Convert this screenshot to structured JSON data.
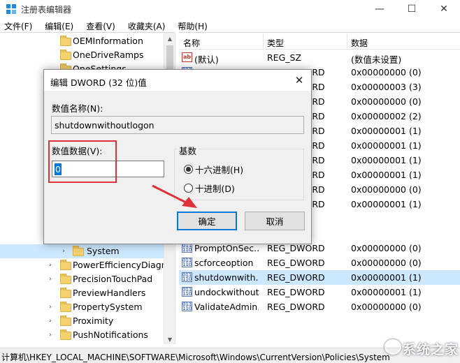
{
  "window": {
    "title": "注册表编辑器",
    "controls": {
      "minimize": "—",
      "maximize": "☐",
      "close": "✕"
    }
  },
  "menu": [
    "文件(F)",
    "编辑(E)",
    "查看(V)",
    "收藏夹(A)",
    "帮助(H)"
  ],
  "tree": {
    "items": [
      {
        "label": "OEMInformation",
        "arrow": ""
      },
      {
        "label": "OneDriveRamps",
        "arrow": ""
      },
      {
        "label": "OneSettings",
        "arrow": ""
      },
      {
        "label": "System",
        "arrow": "›",
        "selected": true
      },
      {
        "label": "PowerEfficiencyDiagnostics",
        "arrow": "›"
      },
      {
        "label": "PrecisionTouchPad",
        "arrow": "›"
      },
      {
        "label": "PreviewHandlers",
        "arrow": ""
      },
      {
        "label": "PropertySystem",
        "arrow": "›"
      },
      {
        "label": "Proximity",
        "arrow": "›"
      },
      {
        "label": "PushNotifications",
        "arrow": "›"
      }
    ]
  },
  "values_table": {
    "headers": {
      "name": "名称",
      "type": "类型",
      "data": "数据"
    },
    "rows": [
      {
        "icon": "string-value-icon",
        "name": "(默认)",
        "type": "REG_SZ",
        "data": "(数值未设置)"
      },
      {
        "icon": "dword-value-icon",
        "name": "",
        "type": "REG_DWORD",
        "data": "0x00000000 (0)"
      },
      {
        "icon": "dword-value-icon",
        "name": "",
        "type": "REG_DWORD",
        "data": "0x00000003 (3)"
      },
      {
        "icon": "dword-value-icon",
        "name": "",
        "type": "REG_DWORD",
        "data": "0x00000000 (0)"
      },
      {
        "icon": "dword-value-icon",
        "name": "",
        "type": "REG_DWORD",
        "data": "0x00000002 (2)"
      },
      {
        "icon": "dword-value-icon",
        "name": "",
        "type": "REG_DWORD",
        "data": "0x00000001 (1)"
      },
      {
        "icon": "dword-value-icon",
        "name": "",
        "type": "REG_DWORD",
        "data": "0x00000001 (1)"
      },
      {
        "icon": "dword-value-icon",
        "name": "",
        "type": "REG_DWORD",
        "data": "0x00000001 (1)"
      },
      {
        "icon": "dword-value-icon",
        "name": "",
        "type": "REG_DWORD",
        "data": "0x00000001 (1)"
      },
      {
        "icon": "dword-value-icon",
        "name": "",
        "type": "REG_DWORD",
        "data": "0x00000000 (0)"
      },
      {
        "icon": "dword-value-icon",
        "name": "",
        "type": "REG_DWORD",
        "data": "0x00000001 (1)"
      },
      {
        "icon": "dword-value-icon",
        "name": "",
        "type": "",
        "data": ""
      },
      {
        "icon": "dword-value-icon",
        "name": "PromptOnSec...",
        "type": "REG_DWORD",
        "data": "0x00000000 (0)"
      },
      {
        "icon": "dword-value-icon",
        "name": "scforceoption",
        "type": "REG_DWORD",
        "data": "0x00000000 (0)"
      },
      {
        "icon": "dword-value-icon",
        "name": "shutdownwith...",
        "type": "REG_DWORD",
        "data": "0x00000001 (1)",
        "selected": true
      },
      {
        "icon": "dword-value-icon",
        "name": "undockwithout...",
        "type": "REG_DWORD",
        "data": "0x00000001 (1)"
      },
      {
        "icon": "dword-value-icon",
        "name": "ValidateAdmin...",
        "type": "REG_DWORD",
        "data": "0x00000000 (0)"
      }
    ]
  },
  "statusbar": {
    "path": "计算机\\HKEY_LOCAL_MACHINE\\SOFTWARE\\Microsoft\\Windows\\CurrentVersion\\Policies\\System"
  },
  "dialog": {
    "title": "编辑 DWORD (32 位)值",
    "value_name_label": "数值名称(N):",
    "value_name": "shutdownwithoutlogon",
    "value_data_label": "数值数据(V):",
    "value_data": "0",
    "base_label": "基数",
    "radio_hex": "十六进制(H)",
    "radio_dec": "十进制(D)",
    "selected_base": "hex",
    "ok": "确定",
    "cancel": "取消",
    "close": "✕"
  },
  "annotation_colors": {
    "highlight_box": "#e0303a",
    "arrow": "#e0303a"
  },
  "watermark": {
    "text": "系统之家"
  }
}
